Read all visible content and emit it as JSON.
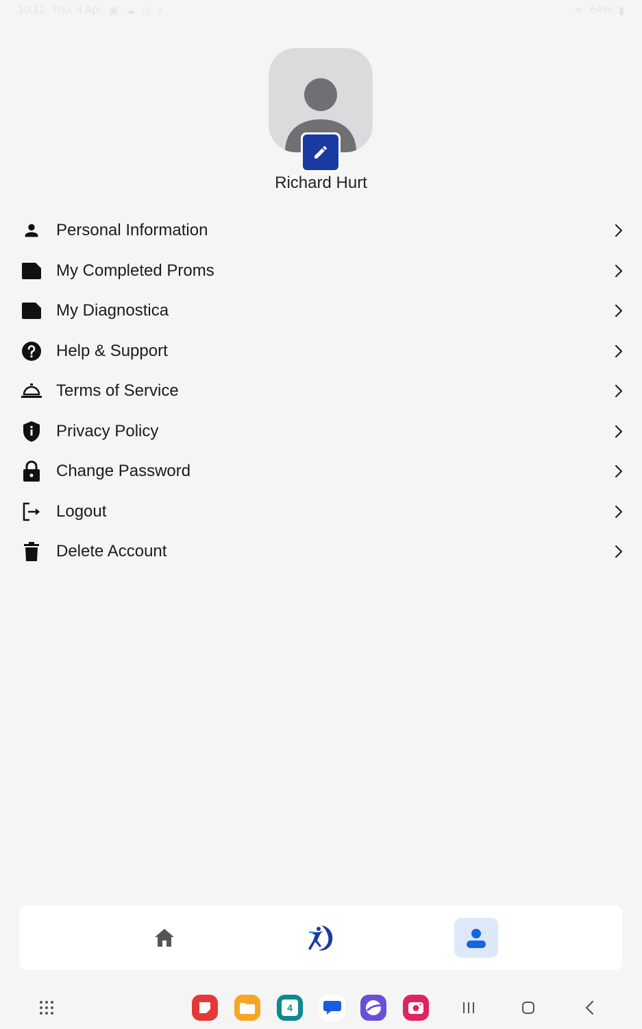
{
  "status_bar": {
    "time": "10:11",
    "date": "Thu, 4 Apr",
    "battery": "64%"
  },
  "profile": {
    "name": "Richard Hurt"
  },
  "menu": {
    "items": [
      {
        "label": "Personal Information",
        "icon": "person-icon"
      },
      {
        "label": "My Completed Proms",
        "icon": "folder-icon"
      },
      {
        "label": "My Diagnostica",
        "icon": "folder-icon"
      },
      {
        "label": "Help & Support",
        "icon": "help-circle-icon"
      },
      {
        "label": "Terms of Service",
        "icon": "service-bell-icon"
      },
      {
        "label": "Privacy Policy",
        "icon": "shield-icon"
      },
      {
        "label": "Change Password",
        "icon": "lock-icon"
      },
      {
        "label": "Logout",
        "icon": "logout-icon"
      },
      {
        "label": "Delete Account",
        "icon": "trash-icon"
      }
    ]
  },
  "bottom_nav": {
    "items": [
      "home-icon",
      "app-logo-icon",
      "profile-icon"
    ],
    "active": "profile-icon",
    "active_bg": "#dde9fb",
    "active_color": "#1565e0"
  },
  "dock": {
    "calendar_day": "4"
  },
  "colors": {
    "background": "#f5f5f5",
    "edit_badge": "#1a3aa3",
    "text": "#1c1c1c"
  }
}
